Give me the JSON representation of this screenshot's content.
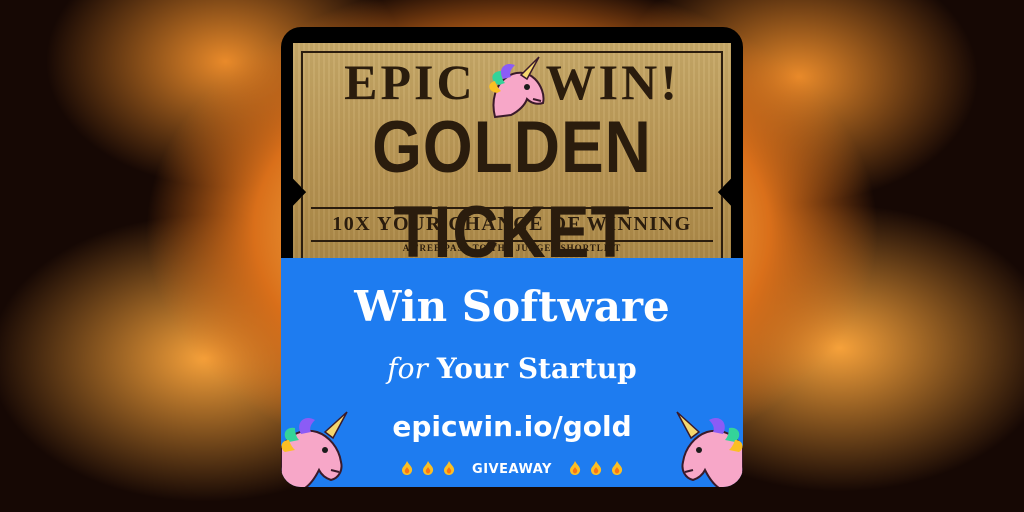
{
  "ticket": {
    "word_left": "EPIC",
    "word_right": "WIN!",
    "title": "GOLDEN TICKET",
    "tagline": "10X YOUR CHANCE OF WINNING",
    "fineprint": "A FREE PASS TO THE JUDGES SHORTLIST"
  },
  "promo": {
    "headline": "Win Software",
    "sub_italic": "for",
    "sub_rest": "Your Startup",
    "url": "epicwin.io/gold",
    "giveaway": "GIVEAWAY"
  },
  "icons": {
    "mascot": "unicorn-icon",
    "flame": "fire-icon"
  },
  "colors": {
    "ticket_gold": "#b99654",
    "ticket_ink": "#2a1c0d",
    "promo_blue": "#1e7cf0",
    "unicorn_pink": "#f7a7c8"
  }
}
